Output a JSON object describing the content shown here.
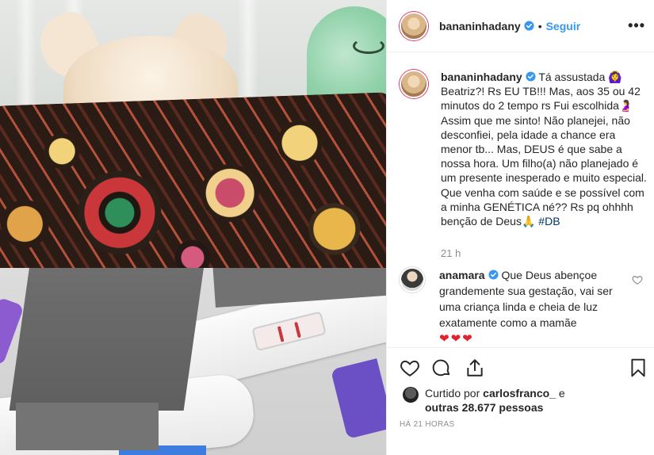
{
  "post": {
    "username": "bananinhadany",
    "separator": "•",
    "follow_label": "Seguir",
    "more_label": "•••",
    "caption_username": "bananinhadany",
    "caption_body": " Tá assustada 🙆‍♀️ Beatriz?! Rs EU TB!!! Mas, aos 35 ou 42 minutos do 2 tempo rs Fui escolhida🤰 Assim que me sinto! Não planejei, não desconfiei, pela idade a chance era menor tb... Mas, DEUS é que sabe a nossa hora. Um filho(a) não planejado é um presente inesperado e muito especial. Que venha com saúde e se possível com a minha GENÉTICA né?? Rs pq ohhhh benção de Deus🙏 ",
    "hashtag": "#DB",
    "time_ago": "21 h"
  },
  "comment": {
    "username": "anamara",
    "text": " Que Deus abençoe grandemente sua gestação, vai ser uma criança linda e cheia de luz exatamente como a mamãe",
    "hearts": "❤❤❤"
  },
  "likes": {
    "prefix": "Curtido por ",
    "liker": "carlosfranco_",
    "connector": " e",
    "others": "outras 28.677 pessoas"
  },
  "timestamp": "HÁ 21 HORAS",
  "colors": {
    "link_blue": "#3897f0",
    "hashtag": "#003569",
    "muted": "#8e8e8e",
    "verified": "#3897f0",
    "heart_red": "#e0232e"
  },
  "icons": [
    "verified-icon",
    "more-options-icon",
    "like-icon",
    "comment-icon",
    "share-icon",
    "bookmark-icon",
    "comment-like-icon"
  ]
}
